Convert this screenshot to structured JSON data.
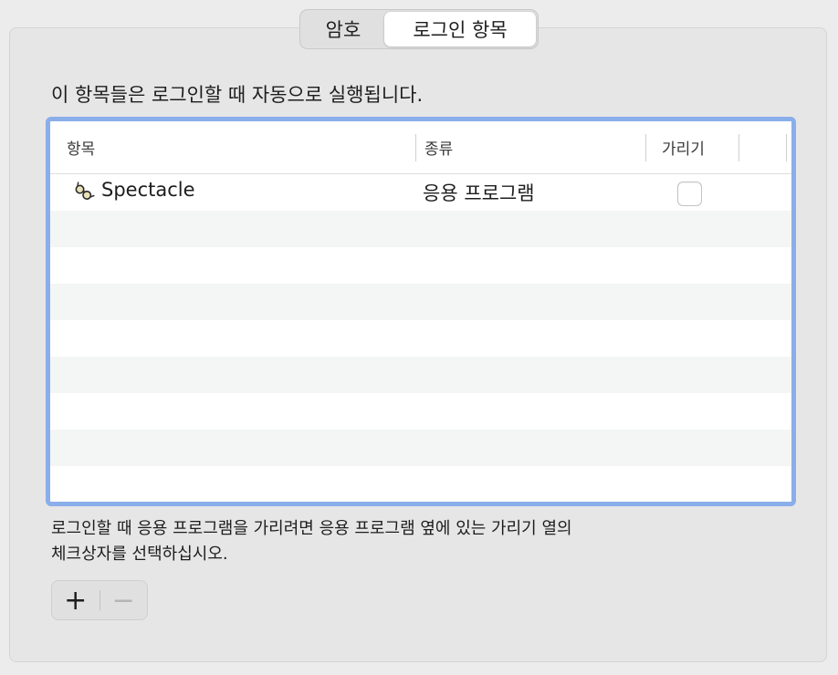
{
  "tabs": [
    {
      "label": "암호",
      "selected": false
    },
    {
      "label": "로그인 항목",
      "selected": true
    }
  ],
  "intro_text": "이 항목들은 로그인할 때 자동으로 실행됩니다.",
  "table": {
    "columns": [
      "항목",
      "종류",
      "가리기"
    ],
    "rows": [
      {
        "name": "Spectacle",
        "kind": "응용 프로그램",
        "hidden": false,
        "icon": "spectacle-app-icon"
      }
    ]
  },
  "hint_line1": "로그인할 때 응용 프로그램을 가리려면 응용 프로그램 옆에 있는 가리기 열의",
  "hint_line2": "체크상자를 선택하십시오.",
  "buttons": {
    "add_label": "+",
    "remove_label": "−"
  },
  "colors": {
    "focus_ring": "#8aaeea",
    "stripe": "#f4f5f5"
  }
}
